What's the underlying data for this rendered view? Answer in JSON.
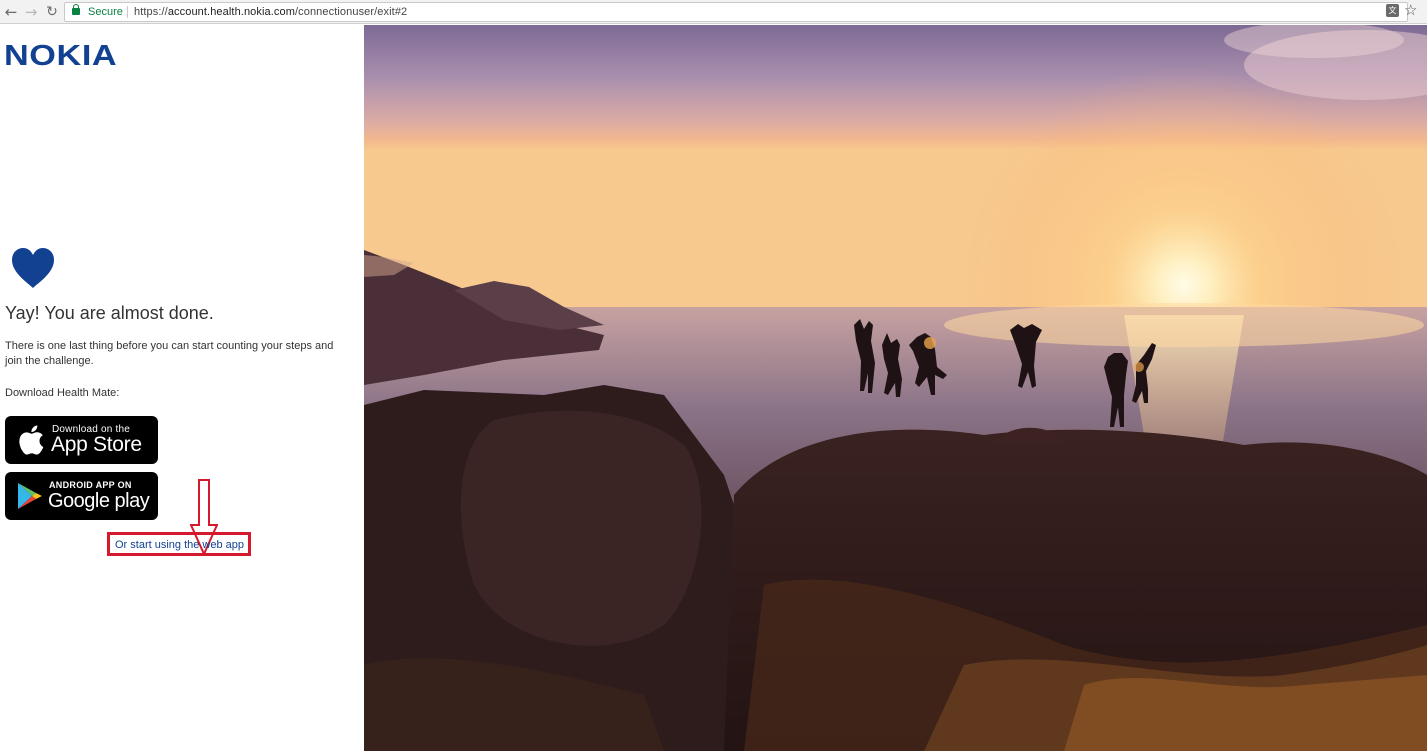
{
  "browser": {
    "secure_label": "Secure",
    "url_prefix": "https://",
    "url_host": "account.health.nokia.com",
    "url_path": "/connectionuser/exit#2",
    "icons": [
      "back-arrow-icon",
      "forward-arrow-icon",
      "reload-icon",
      "lock-icon",
      "translate-icon",
      "bookmark-star-icon"
    ]
  },
  "brand": {
    "logo_text": "NOKIA",
    "color": "#124191"
  },
  "main": {
    "heart_icon": "heart-icon",
    "headline": "Yay! You are almost done.",
    "description": "There is one last thing before you can start counting your steps and join the challenge.",
    "download_label": "Download Health Mate:",
    "app_store": {
      "small": "Download on the",
      "big": "App Store"
    },
    "google_play": {
      "small": "ANDROID APP ON",
      "big": "Google play"
    },
    "web_app_link": "Or start using the web app"
  },
  "annotation": {
    "highlight_color": "#d4192c"
  }
}
